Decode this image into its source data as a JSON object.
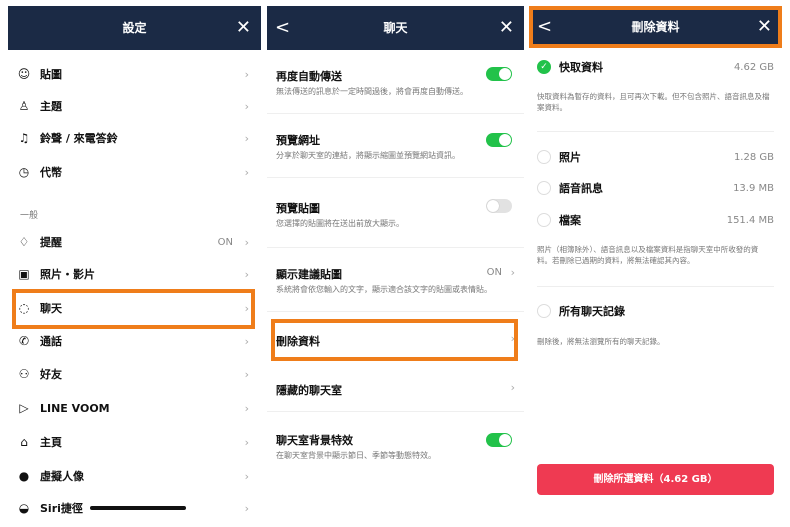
{
  "panel1": {
    "title": "設定",
    "close": "✕",
    "items": [
      {
        "icon": "☺",
        "label": "貼圖",
        "value": ""
      },
      {
        "icon": "♙",
        "label": "主題",
        "value": ""
      },
      {
        "icon": "♫",
        "label": "鈴聲 / 來電答鈴",
        "value": ""
      },
      {
        "icon": "◷",
        "label": "代幣",
        "value": ""
      }
    ],
    "section": "一般",
    "general": [
      {
        "icon": "♢",
        "label": "提醒",
        "value": "ON"
      },
      {
        "icon": "▣",
        "label": "照片・影片",
        "value": ""
      },
      {
        "icon": "◌",
        "label": "聊天",
        "value": ""
      },
      {
        "icon": "✆",
        "label": "通話",
        "value": ""
      },
      {
        "icon": "⚇",
        "label": "好友",
        "value": ""
      },
      {
        "icon": "▷",
        "label": "LINE VOOM",
        "value": ""
      },
      {
        "icon": "⌂",
        "label": "主頁",
        "value": ""
      },
      {
        "icon": "●",
        "label": "虛擬人像",
        "value": ""
      },
      {
        "icon": "◒",
        "label": "Siri捷徑",
        "value": ""
      }
    ]
  },
  "panel2": {
    "title": "聊天",
    "back": "<",
    "close": "✕",
    "rows": [
      {
        "title": "再度自動傳送",
        "desc": "無法傳送的訊息於一定時間過後，將會再度自動傳送。",
        "toggle": "on"
      },
      {
        "title": "預覽網址",
        "desc": "分享於聊天室的連結，將顯示縮圖並預覽網站資訊。",
        "toggle": "on"
      },
      {
        "title": "預覽貼圖",
        "desc": "您選擇的貼圖將在送出前放大顯示。",
        "toggle": "off"
      },
      {
        "title": "顯示建議貼圖",
        "desc": "系統將會依您輸入的文字，顯示適合該文字的貼圖或表情貼。",
        "value": "ON"
      },
      {
        "title": "刪除資料",
        "desc": ""
      },
      {
        "title": "隱藏的聊天室",
        "desc": ""
      },
      {
        "title": "聊天室背景特效",
        "desc": "在聊天室背景中顯示節日、季節等動態特效。",
        "toggle": "on"
      }
    ]
  },
  "panel3": {
    "title": "刪除資料",
    "back": "<",
    "close": "✕",
    "cache": {
      "label": "快取資料",
      "size": "4.62 GB",
      "note": "快取資料為暫存的資料，且可再次下載。但不包含照片、語音訊息及檔案資料。"
    },
    "media": [
      {
        "label": "照片",
        "size": "1.28 GB"
      },
      {
        "label": "語音訊息",
        "size": "13.9 MB"
      },
      {
        "label": "檔案",
        "size": "151.4 MB"
      }
    ],
    "media_note": "照片（相簿除外）、語音訊息以及檔案資料是指聊天室中所收發的資料。若刪除已過期的資料，將無法確認其內容。",
    "all": {
      "label": "所有聊天記錄",
      "note": "刪除後，將無法瀏覽所有的聊天記錄。"
    },
    "button": "刪除所選資料（4.62 GB）"
  },
  "colors": {
    "header": "#1b2a45",
    "highlight": "#ef7d1a",
    "toggle_on": "#22c24a",
    "delete": "#ef3a52"
  }
}
